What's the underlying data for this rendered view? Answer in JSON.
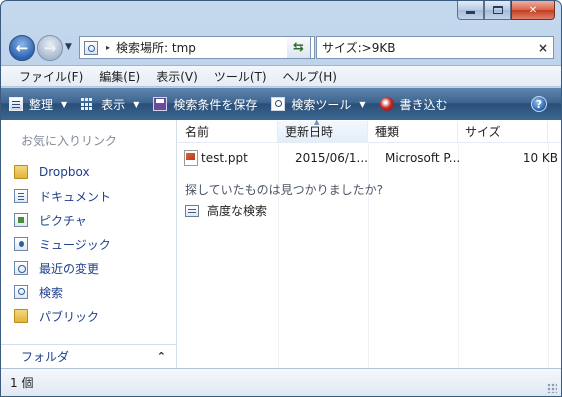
{
  "window": {
    "caption_buttons": [
      "minimize",
      "maximize",
      "close"
    ]
  },
  "address_bar": {
    "separator": "▸",
    "location": "検索場所: tmp",
    "dropdown_arrow": "▼",
    "refresh_symbol": "⇆"
  },
  "search": {
    "value": "サイズ:>9KB",
    "clear_symbol": "×"
  },
  "menu": {
    "items": [
      "ファイル(F)",
      "編集(E)",
      "表示(V)",
      "ツール(T)",
      "ヘルプ(H)"
    ]
  },
  "toolbar": {
    "organize": "整理",
    "view": "表示",
    "save_search": "検索条件を保存",
    "search_tools": "検索ツール",
    "burn": "書き込む",
    "help_symbol": "?"
  },
  "nav_pane": {
    "favorites_title": "お気に入りリンク",
    "items": [
      {
        "label": "Dropbox",
        "icon": "folder-icon"
      },
      {
        "label": "ドキュメント",
        "icon": "documents-icon"
      },
      {
        "label": "ピクチャ",
        "icon": "pictures-icon"
      },
      {
        "label": "ミュージック",
        "icon": "music-icon"
      },
      {
        "label": "最近の変更",
        "icon": "recent-changes-icon"
      },
      {
        "label": "検索",
        "icon": "searches-icon"
      },
      {
        "label": "パブリック",
        "icon": "folder-icon"
      }
    ],
    "folders_label": "フォルダ",
    "folders_chevron": "⌃"
  },
  "file_list": {
    "columns": [
      "名前",
      "更新日時",
      "種類",
      "サイズ"
    ],
    "sort_indicator": "▲",
    "rows": [
      {
        "name": "test.ppt",
        "date": "2015/06/1...",
        "type": "Microsoft P...",
        "size": "10 KB"
      }
    ],
    "search_again_text": "探していたものは見つかりましたか?",
    "advanced_search_label": "高度な検索"
  },
  "status": {
    "item_count": "1 個"
  },
  "colors": {
    "command_bar": "#3f6690",
    "link_text": "#1e3f8a",
    "window_frame": "#b5cde6"
  }
}
